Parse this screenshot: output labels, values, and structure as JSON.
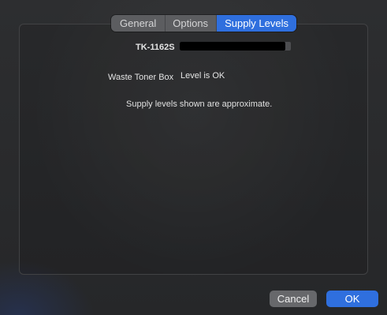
{
  "tabs": [
    {
      "label": "General",
      "active": false
    },
    {
      "label": "Options",
      "active": false
    },
    {
      "label": "Supply Levels",
      "active": true
    }
  ],
  "supplies": {
    "toner": {
      "name": "TK-1162S",
      "level_fraction": 0.95
    },
    "waste": {
      "label": "Waste Toner Box",
      "status": "Level is OK"
    }
  },
  "note": "Supply levels shown are approximate.",
  "buttons": {
    "cancel": "Cancel",
    "ok": "OK"
  },
  "colors": {
    "accent": "#2f6fde",
    "level_bar": "#000000",
    "track": "#4d4e51"
  }
}
